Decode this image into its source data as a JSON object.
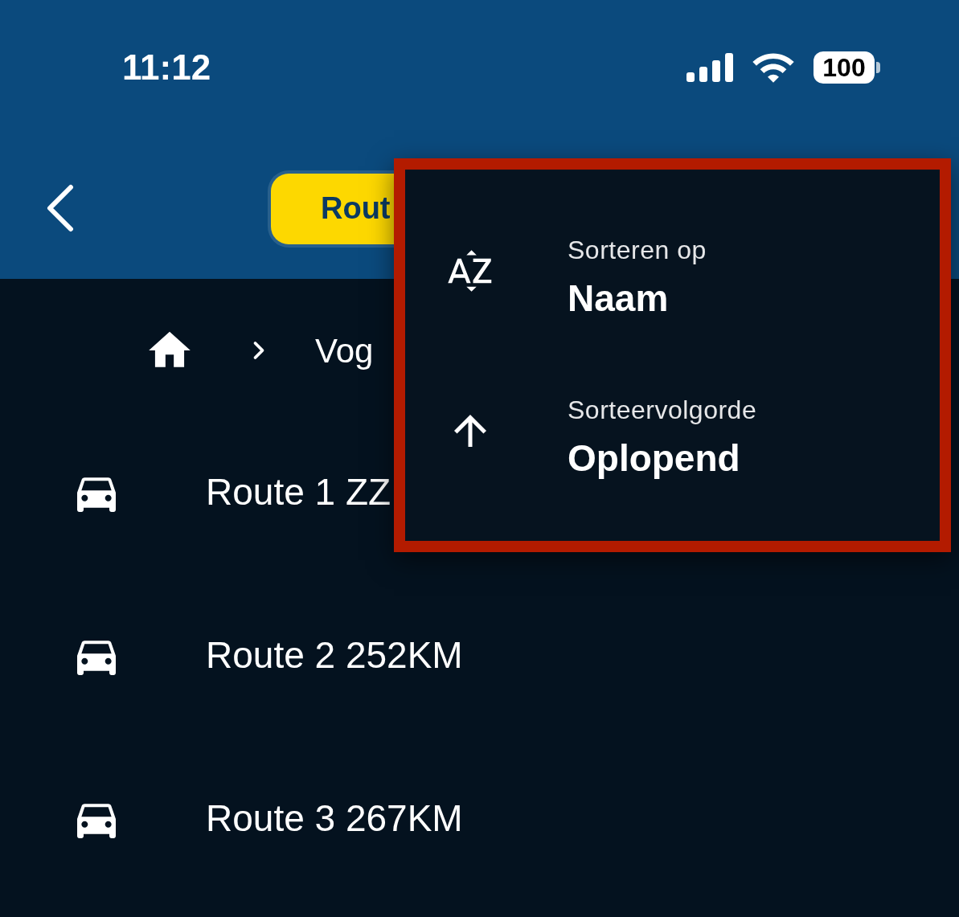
{
  "status_bar": {
    "time": "11:12",
    "battery": "100"
  },
  "header": {
    "route_button": "Rout"
  },
  "breadcrumb": {
    "current": "Vog"
  },
  "routes": [
    {
      "name": "Route 1 ZZ"
    },
    {
      "name": "Route 2 252KM"
    },
    {
      "name": "Route 3 267KM"
    }
  ],
  "sort_menu": {
    "items": [
      {
        "kind": "sort_field",
        "label": "Sorteren op",
        "value": "Naam"
      },
      {
        "kind": "sort_order",
        "label": "Sorteervolgorde",
        "value": "Oplopend"
      }
    ]
  }
}
